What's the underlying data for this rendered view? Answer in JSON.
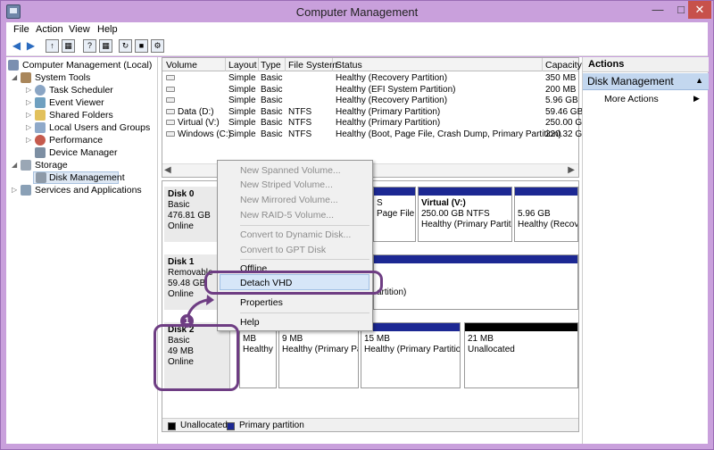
{
  "window": {
    "title": "Computer Management"
  },
  "menubar": {
    "items": [
      "File",
      "Action",
      "View",
      "Help"
    ]
  },
  "tree": {
    "items": [
      {
        "label": "Computer Management (Local)",
        "icon": "computer-icon"
      },
      {
        "label": "System Tools",
        "icon": "tools-icon"
      },
      {
        "label": "Task Scheduler",
        "icon": "clock-icon"
      },
      {
        "label": "Event Viewer",
        "icon": "event-viewer-icon"
      },
      {
        "label": "Shared Folders",
        "icon": "folder-icon"
      },
      {
        "label": "Local Users and Groups",
        "icon": "users-icon"
      },
      {
        "label": "Performance",
        "icon": "performance-icon"
      },
      {
        "label": "Device Manager",
        "icon": "device-manager-icon"
      },
      {
        "label": "Storage",
        "icon": "storage-icon"
      },
      {
        "label": "Disk Management",
        "icon": "disk-management-icon"
      },
      {
        "label": "Services and Applications",
        "icon": "services-icon"
      }
    ]
  },
  "volume_list": {
    "headers": [
      "Volume",
      "Layout",
      "Type",
      "File System",
      "Status",
      "Capacity"
    ],
    "rows": [
      [
        "",
        "Simple",
        "Basic",
        "",
        "Healthy (Recovery Partition)",
        "350 MB"
      ],
      [
        "",
        "Simple",
        "Basic",
        "",
        "Healthy (EFI System Partition)",
        "200 MB"
      ],
      [
        "",
        "Simple",
        "Basic",
        "",
        "Healthy (Recovery Partition)",
        "5.96 GB"
      ],
      [
        "Data (D:)",
        "Simple",
        "Basic",
        "NTFS",
        "Healthy (Primary Partition)",
        "59.46 GB"
      ],
      [
        "Virtual (V:)",
        "Simple",
        "Basic",
        "NTFS",
        "Healthy (Primary Partition)",
        "250.00 GE"
      ],
      [
        "Windows (C:)",
        "Simple",
        "Basic",
        "NTFS",
        "Healthy (Boot, Page File, Crash Dump, Primary Partition)",
        "220.32 GE"
      ]
    ]
  },
  "disks": {
    "disk0": {
      "name": "Disk 0",
      "type": "Basic",
      "size": "476.81 GB",
      "state": "Online"
    },
    "disk1": {
      "name": "Disk 1",
      "type": "Removable",
      "size": "59.48 GB",
      "state": "Online"
    },
    "disk2": {
      "name": "Disk 2",
      "type": "Basic",
      "size": "49 MB",
      "state": "Online"
    }
  },
  "partitions": {
    "d0_p_fragment": "S",
    "d0_p_fragment2": "Page File",
    "d0_virtual_name": "Virtual  (V:)",
    "d0_virtual_size": "250.00 GB NTFS",
    "d0_virtual_status": "Healthy (Primary Partitio",
    "d0_last_size": "5.96 GB",
    "d0_last_status": "Healthy (Recove",
    "d1_fragment": "artition)",
    "d2_p1_size": "MB",
    "d2_p1_status": "Healthy",
    "d2_p2_size": "9 MB",
    "d2_p2_status": "Healthy (Primary Pa",
    "d2_p3_size": "15 MB",
    "d2_p3_status": "Healthy (Primary Partition",
    "d2_p4_size": "21 MB",
    "d2_p4_status": "Unallocated"
  },
  "legend": {
    "unallocated": "Unallocated",
    "primary": "Primary partition"
  },
  "actions": {
    "header": "Actions",
    "section": "Disk Management",
    "more": "More Actions"
  },
  "context_menu": {
    "items": [
      {
        "label": "New Spanned Volume...",
        "enabled": false
      },
      {
        "label": "New Striped Volume...",
        "enabled": false
      },
      {
        "label": "New Mirrored Volume...",
        "enabled": false
      },
      {
        "label": "New RAID-5 Volume...",
        "enabled": false
      },
      {
        "label": "Convert to Dynamic Disk...",
        "enabled": false
      },
      {
        "label": "Convert to GPT Disk",
        "enabled": false
      },
      {
        "label": "Offline",
        "enabled": true
      },
      {
        "label": "Detach VHD",
        "enabled": true
      },
      {
        "label": "Properties",
        "enabled": true
      },
      {
        "label": "Help",
        "enabled": true
      }
    ]
  },
  "callout": {
    "number": "1",
    "color": "#6e3d83"
  },
  "colors": {
    "primary_partition": "#1c2893",
    "unallocated": "#000000",
    "title_bar": "#c9a0dc"
  }
}
